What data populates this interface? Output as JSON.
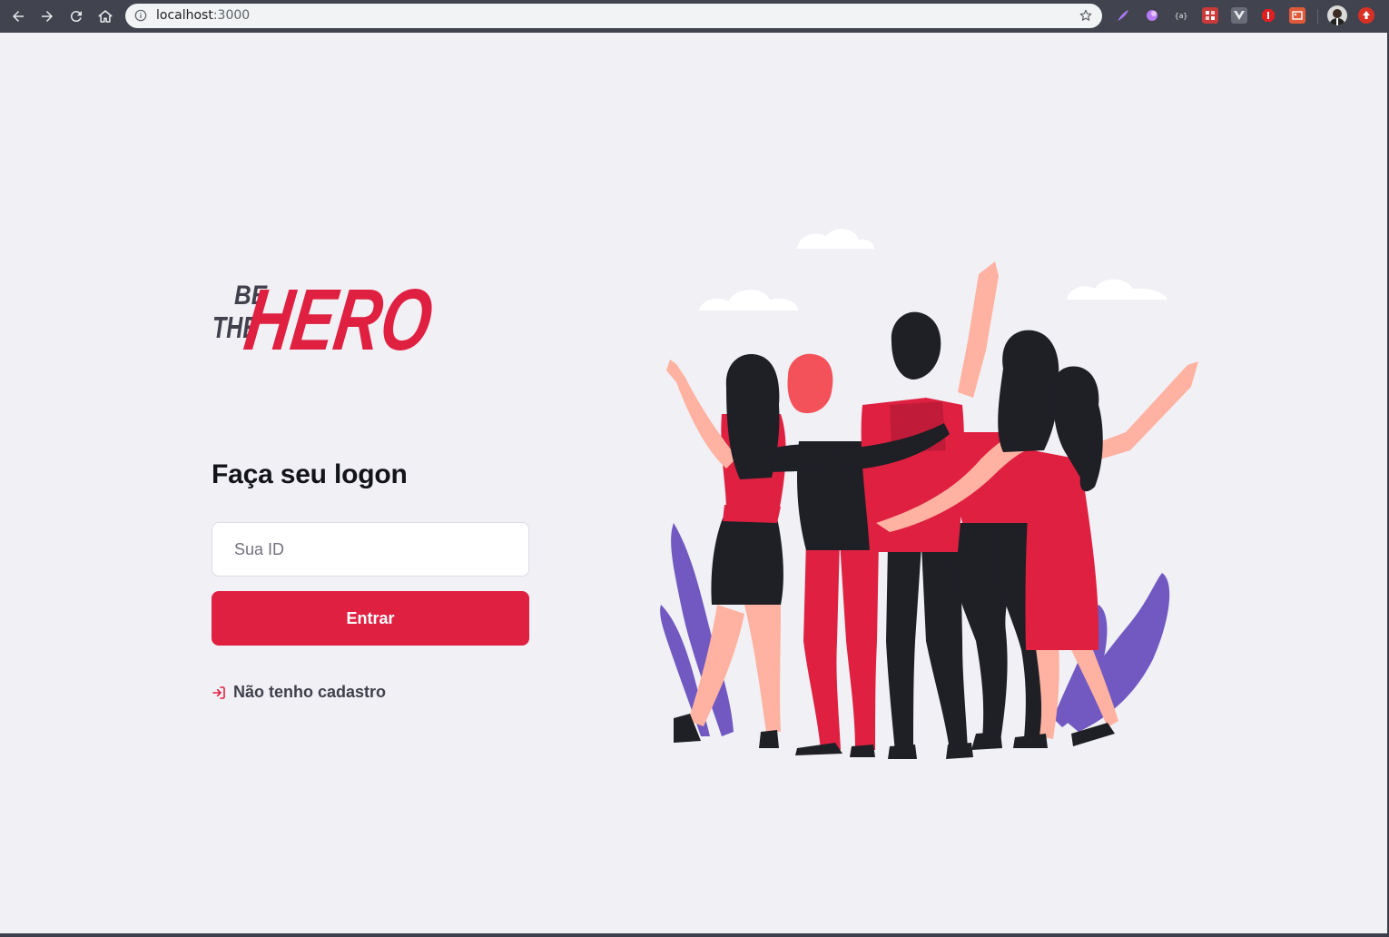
{
  "browser": {
    "url_host": "localhost",
    "url_port": ":3000",
    "icons": {
      "back": "arrow-left-icon",
      "forward": "arrow-right-icon",
      "reload": "reload-icon",
      "home": "home-icon",
      "info": "info-icon",
      "bookmark": "star-icon"
    },
    "extensions": [
      {
        "name": "feather-extension-icon",
        "color": "#7b5cd6"
      },
      {
        "name": "graphql-extension-icon",
        "color": "#9b6cf0"
      },
      {
        "name": "json-extension-icon",
        "color": "#41434f"
      },
      {
        "name": "pixel-extension-icon",
        "color": "#d64545"
      },
      {
        "name": "vue-extension-icon",
        "color": "#6a6d78"
      },
      {
        "name": "stop-extension-icon",
        "color": "#e02020"
      },
      {
        "name": "image-extension-icon",
        "color": "#e05a3a"
      }
    ]
  },
  "brand": {
    "logo_line1": "BE",
    "logo_line2": "THE",
    "logo_word": "HERO",
    "accent": "#e02041"
  },
  "logon": {
    "title": "Faça seu logon",
    "id_placeholder": "Sua ID",
    "id_value": "",
    "submit_label": "Entrar",
    "register_label": "Não tenho cadastro",
    "register_icon": "log-in-icon"
  },
  "illustration": {
    "name": "heroes-illustration"
  }
}
